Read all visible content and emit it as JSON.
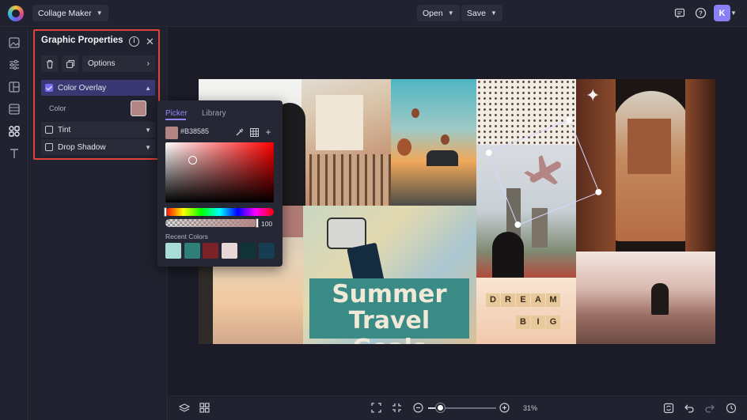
{
  "topbar": {
    "app_mode": "Collage Maker",
    "open_label": "Open",
    "save_label": "Save",
    "user_initial": "K",
    "icons": [
      "logo-icon",
      "chat-icon",
      "help-icon",
      "chevron-down-icon"
    ]
  },
  "rail": {
    "items": [
      "image-icon",
      "adjustments-icon",
      "layout-icon",
      "backgrounds-icon",
      "graphics-icon",
      "text-icon"
    ],
    "active": "graphics-icon"
  },
  "properties": {
    "title": "Graphic Properties",
    "options_label": "Options",
    "color_overlay": {
      "label": "Color Overlay",
      "checked": true,
      "expanded": true
    },
    "color_label": "Color",
    "tint": {
      "label": "Tint",
      "checked": false
    },
    "drop_shadow": {
      "label": "Drop Shadow",
      "checked": false
    }
  },
  "picker": {
    "tabs": [
      "Picker",
      "Library"
    ],
    "active_tab": "Picker",
    "hex": "#B38585",
    "alpha": "100",
    "recent_label": "Recent Colors",
    "recent_colors": [
      "#a8ddd6",
      "#2f7f79",
      "#7a2228",
      "#e9d6d6",
      "#0f3337",
      "#153e52"
    ]
  },
  "collage": {
    "title_line1": "Summer",
    "title_line2": "Travel Goals",
    "tiles_letters_1": [
      "D",
      "R",
      "E",
      "A",
      "M"
    ],
    "tiles_letters_2": [
      "B",
      "I",
      "G"
    ]
  },
  "bottombar": {
    "zoom": "31%",
    "zoom_fraction": 0.18
  },
  "colors": {
    "accent": "#7b6cf0",
    "highlight_box": "#e0433a",
    "overlay_color": "#b38585"
  }
}
